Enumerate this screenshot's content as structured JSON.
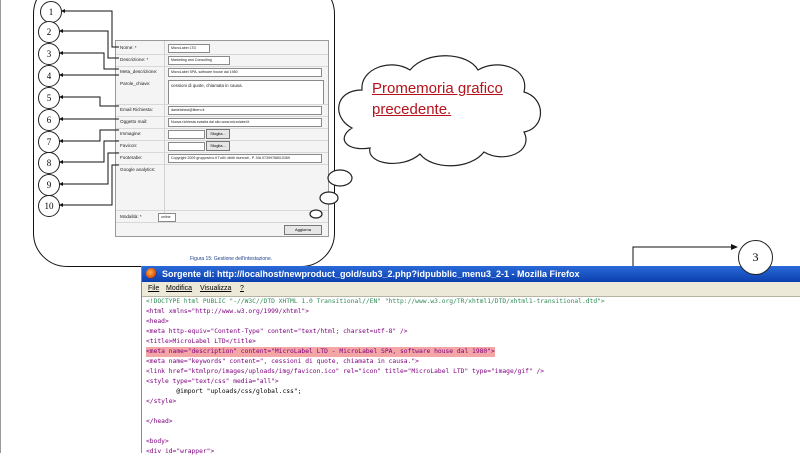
{
  "reminder": "Promemoria grafico precedente.",
  "figure_caption": "Figura 15: Gestione dell'intestazione.",
  "circle_numbers": [
    "1",
    "2",
    "3",
    "4",
    "5",
    "6",
    "7",
    "8",
    "9",
    "10"
  ],
  "callout_number": "3",
  "form": {
    "fields": [
      {
        "label": "Nome: *",
        "value": "MicroLabel LTD"
      },
      {
        "label": "Descrizione: *",
        "value": "Marketing and Consulting"
      },
      {
        "label": "Meta_descrizione:",
        "value": "MicroLabel SPA, software house dal 1980"
      },
      {
        "label": "Parole_chiave:",
        "value": "cessioni di quote, chiamata in causa."
      },
      {
        "label": "Email Richiesta:",
        "value": "danielaheci@libero.it"
      },
      {
        "label": "Oggetto mail:",
        "value": "Nuova richiesta evasita dal sito www.microlabel.it"
      },
      {
        "label": "Immagine:",
        "value": ""
      },
      {
        "label": "Favicon:",
        "value": ""
      },
      {
        "label": "Footerabe:",
        "value": "Copyright 2009 gruppovivo.it  Tutti i diritti riservati - P. IVA 07399788010369"
      },
      {
        "label": "Google analytics:",
        "value": ""
      }
    ],
    "browse_label": "Sfoglia...",
    "modality_label": "Modalità: *",
    "modality_value": "online",
    "submit_label": "Aggiorna"
  },
  "browser": {
    "title": "Sorgente di: http://localhost/newproduct_gold/sub3_2.php?idpubblic_menu3_2-1 - Mozilla Firefox",
    "menu": [
      "File",
      "Modifica",
      "Visualizza",
      "?"
    ]
  },
  "source": {
    "doctype": "<!DOCTYPE html PUBLIC \"-//W3C//DTD XHTML 1.0 Transitional//EN\" \"http://www.w3.org/TR/xhtml1/DTD/xhtml1-transitional.dtd\">",
    "html_open": "<html xmlns=\"http://www.w3.org/1999/xhtml\">",
    "head_open": "<head>",
    "meta_content_type": "<meta http-equiv=\"Content-Type\" content=\"text/html; charset=utf-8\" />",
    "title": "<title>MicroLabel LTD</title>",
    "meta_description": "<meta name=\"description\" content=\"MicroLabel LTD - MicroLabel SPA, software house dal 1980\">",
    "meta_keywords": "<meta name=\"keywords\" content=\", cessioni di quote, chiamata in causa.\">",
    "link_icon": "<link href=\"ktmlpro/images/uploads/img/favicon.ico\" rel=\"icon\" title=\"MicroLabel LTD\" type=\"image/gif\" />",
    "style_open": "<style type=\"text/css\" media=\"all\">",
    "import": "        @import \"uploads/css/global.css\";",
    "style_close": "</style>",
    "head_close": "</head>",
    "body_open": "<body>",
    "div_wrapper": "<div id=\"wrapper\">"
  }
}
